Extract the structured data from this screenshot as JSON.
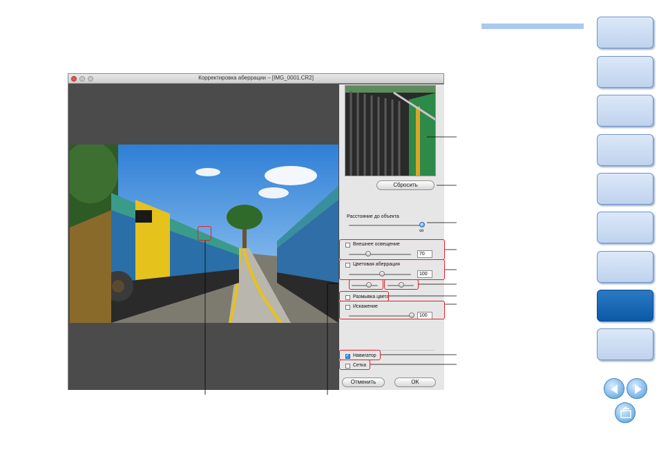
{
  "window": {
    "title": "Корректировка аберрации – [IMG_0001.CR2]"
  },
  "panel": {
    "reset_label": "Сбросить",
    "distance_label": "Расстояние до объекта",
    "infinity_symbol": "∞",
    "peripheral": {
      "label": "Внешнее освещение",
      "value": "70",
      "checked": false
    },
    "chromatic": {
      "label": "Цветовая аберрация",
      "value": "100",
      "checked": false
    },
    "color_blur": {
      "label": "Размывка цвета",
      "checked": false
    },
    "distortion": {
      "label": "Искажение",
      "value": "100",
      "checked": false
    },
    "navigator": {
      "label": "Навигатор",
      "checked": true
    },
    "grid": {
      "label": "Сетка",
      "checked": false
    },
    "cancel_label": "Отменить",
    "ok_label": "OK"
  },
  "sliders": {
    "distance_position": 1.0,
    "peripheral_position": 0.5,
    "chromatic_position": 0.5,
    "chroma_red_position": 0.5,
    "chroma_blue_position": 0.5,
    "distortion_position": 1.0
  },
  "side_tabs": {
    "count": 9,
    "active_index": 7
  },
  "icons": [
    "prev-arrow-icon",
    "next-arrow-icon",
    "return-icon"
  ],
  "colors": {
    "highlight": "#e0202a",
    "tab_active": "#0c5aa7",
    "tab_normal": "#c9daf1",
    "accent_bar": "#a9c9ee"
  }
}
